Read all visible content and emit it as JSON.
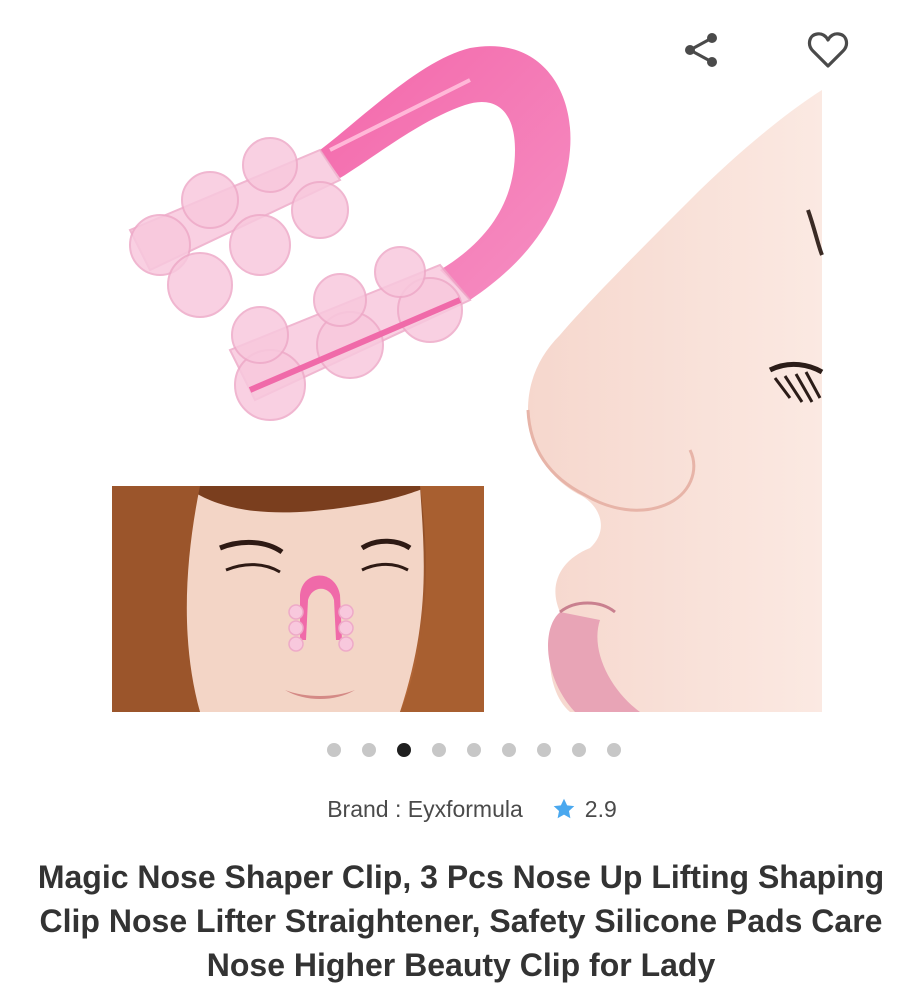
{
  "gallery": {
    "image_count": 9,
    "active_index": 2,
    "images": [
      "product-photo",
      "product-photo",
      "product-photo",
      "product-photo",
      "product-photo",
      "product-photo",
      "product-photo",
      "product-photo",
      "product-photo"
    ]
  },
  "actions": {
    "share_icon": "share-icon",
    "wishlist_icon": "heart-outline-icon"
  },
  "product": {
    "brand_label": "Brand : Eyxformula",
    "rating": "2.9",
    "rating_icon": "star-icon",
    "star_color": "#4aa8ef",
    "title": "Magic Nose Shaper Clip, 3 Pcs Nose Up Lifting Shaping Clip Nose Lifter Straightener, Safety Silicone Pads Care Nose Higher Beauty Clip for Lady"
  },
  "colors": {
    "clip_pink": "#f06aa9",
    "dot_active": "#1f1f1f",
    "dot_inactive": "#c7c7c7"
  }
}
